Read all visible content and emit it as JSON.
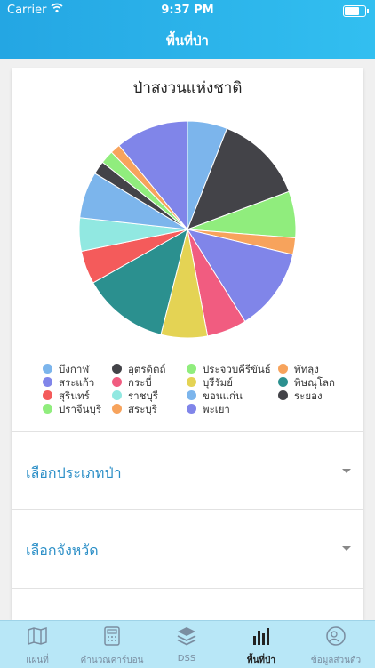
{
  "status": {
    "carrier": "Carrier",
    "time": "9:37 PM"
  },
  "header": {
    "title": "พื้นที่ป่า"
  },
  "filters": [
    {
      "label": "เลือกประเภทป่า"
    },
    {
      "label": "เลือกจังหวัด"
    }
  ],
  "tabs": [
    {
      "label": "แผนที่",
      "icon": "map-icon"
    },
    {
      "label": "คำนวณคาร์บอน",
      "icon": "calculator-icon"
    },
    {
      "label": "DSS",
      "icon": "layers-icon"
    },
    {
      "label": "พื้นที่ป่า",
      "icon": "bar-chart-icon",
      "active": true
    },
    {
      "label": "ข้อมูลส่วนตัว",
      "icon": "profile-icon"
    }
  ],
  "chart_data": {
    "type": "pie",
    "title": "ป่าสงวนแห่งชาติ",
    "legend_position": "bottom",
    "series": [
      {
        "name": "บึงกาฬ",
        "value": 6.0,
        "color": "#7cb5ec"
      },
      {
        "name": "อุตรดิตถ์",
        "value": 13.5,
        "color": "#434348"
      },
      {
        "name": "ประจวบคีรีขันธ์",
        "value": 7.0,
        "color": "#90ed7d"
      },
      {
        "name": "พัทลุง",
        "value": 2.5,
        "color": "#f7a35c"
      },
      {
        "name": "สระแก้ว",
        "value": 12.5,
        "color": "#8085e9"
      },
      {
        "name": "กระบี่",
        "value": 6.0,
        "color": "#f15c80"
      },
      {
        "name": "บุรีรัมย์",
        "value": 7.0,
        "color": "#e4d354"
      },
      {
        "name": "พิษณุโลก",
        "value": 13.0,
        "color": "#2b908f"
      },
      {
        "name": "สุรินทร์",
        "value": 5.0,
        "color": "#f45b5b"
      },
      {
        "name": "ราชบุรี",
        "value": 5.0,
        "color": "#91e8e1"
      },
      {
        "name": "ขอนแก่น",
        "value": 7.0,
        "color": "#7cb5ec"
      },
      {
        "name": "ระยอง",
        "value": 2.0,
        "color": "#434348"
      },
      {
        "name": "ปราจีนบุรี",
        "value": 2.0,
        "color": "#90ed7d"
      },
      {
        "name": "สระบุรี",
        "value": 1.5,
        "color": "#f7a35c"
      },
      {
        "name": "พะเยา",
        "value": 11.0,
        "color": "#8085e9"
      }
    ]
  }
}
